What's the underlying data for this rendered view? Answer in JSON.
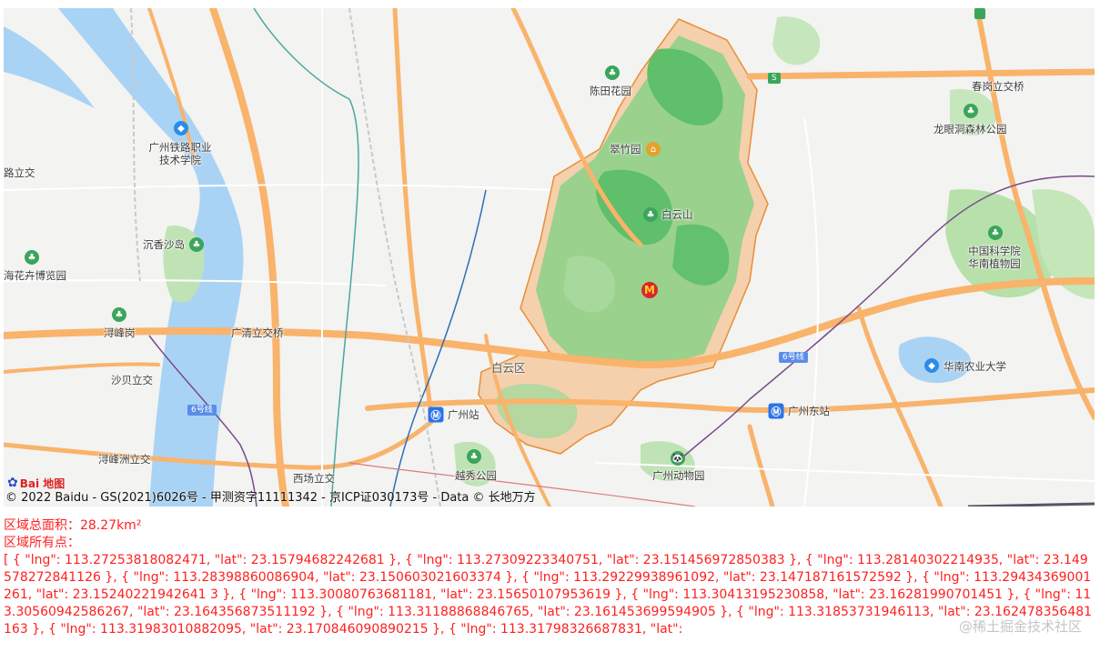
{
  "map": {
    "labels": {
      "chentian_garden": "陈田花园",
      "cuizhu_garden": "翠竹园",
      "baiyun_mountain": "白云山",
      "guangzhou_railway_college": "广州铁路职业\n技术学院",
      "road_cross_left": "路立交",
      "chenxiang_island": "沉香沙岛",
      "flower_expo": "海花卉博览园",
      "xunfenggang": "浔峰岗",
      "guangqing_interchange": "广清立交桥",
      "shabei_interchange": "沙贝立交",
      "xunfengzhou_interchange": "浔峰洲立交",
      "xichang_interchange": "西场立交",
      "guangzhou_station": "广州站",
      "yuexiu_park": "越秀公园",
      "guangzhou_zoo": "广州动物园",
      "guangzhou_east_station": "广州东站",
      "baiyun_district": "白云区",
      "chungang_interchange": "春岗立交桥",
      "longyandong_park": "龙眼洞森林公园",
      "scnbg": "中国科学院\n华南植物园",
      "scau": "华南农业大学",
      "line6_left": "6号线",
      "line6_right": "6号线",
      "s_shield": "S"
    },
    "marker_icon": "mcdonalds-marker",
    "logo_text": "Bai 地图",
    "copyright": "© 2022 Baidu - GS(2021)6026号 - 甲测资字11111342 - 京ICP证030173号 - Data © 长地万方",
    "colors": {
      "polygon_fill": "#f5c9a0",
      "polygon_stroke": "#e98d3a",
      "park_green": "#8fd08a",
      "road_orange": "#f9b36b",
      "water": "#a9d3f5"
    }
  },
  "info": {
    "area_label": "区域总面积：28.27km²",
    "points_label": "区域所有点：",
    "points_text": "[ { \"lng\": 113.27253818082471, \"lat\": 23.15794682242681 }, { \"lng\": 113.27309223340751, \"lat\": 23.151456972850383 }, { \"lng\": 113.28140302214935, \"lat\": 23.149578272841126 }, { \"lng\": 113.28398860086904, \"lat\": 23.150603021603374 }, { \"lng\": 113.29229938961092, \"lat\": 23.147187161572592 }, { \"lng\": 113.29434369001261, \"lat\": 23.15240221942641 3 }, { \"lng\": 113.30080763681181, \"lat\": 23.15650107953619 }, { \"lng\": 113.30413195230858, \"lat\": 23.16281990701451 }, { \"lng\": 113.30560942586267, \"lat\": 23.164356873511192 }, { \"lng\": 113.31188868846765, \"lat\": 23.161453699594905 }, { \"lng\": 113.31853731946113, \"lat\": 23.162478356481163 }, { \"lng\": 113.31983010882095, \"lat\": 23.170846090890215 }, { \"lng\": 113.31798326687831, \"lat\":"
  },
  "watermark": "@稀土掘金技术社区"
}
